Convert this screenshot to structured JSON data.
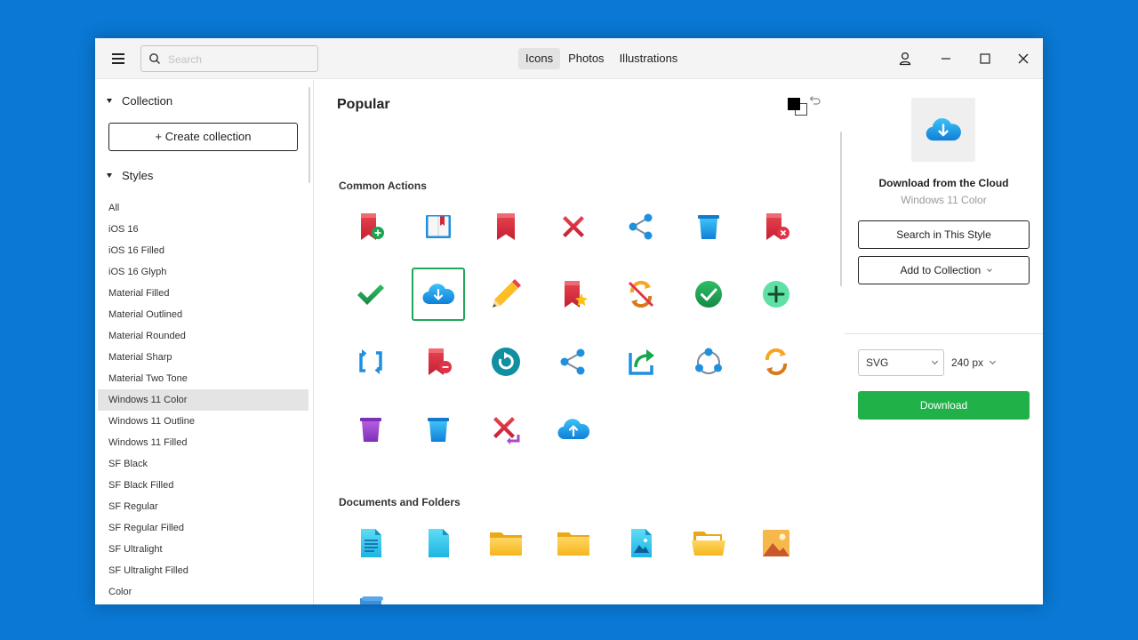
{
  "titlebar": {
    "search_placeholder": "Search",
    "tabs": [
      {
        "label": "Icons",
        "active": true
      },
      {
        "label": "Photos",
        "active": false
      },
      {
        "label": "Illustrations",
        "active": false
      }
    ]
  },
  "sidebar": {
    "collection_heading": "Collection",
    "create_collection_label": "+ Create collection",
    "styles_heading": "Styles",
    "styles": [
      "All",
      "iOS 16",
      "iOS 16 Filled",
      "iOS 16 Glyph",
      "Material Filled",
      "Material Outlined",
      "Material Rounded",
      "Material Sharp",
      "Material Two Tone",
      "Windows 11 Color",
      "Windows 11 Outline",
      "Windows 11 Filled",
      "SF Black",
      "SF Black Filled",
      "SF Regular",
      "SF Regular Filled",
      "SF Ultralight",
      "SF Ultralight Filled",
      "Color"
    ],
    "selected_style": "Windows 11 Color"
  },
  "main": {
    "title": "Popular",
    "sections": [
      {
        "title": "Common Actions",
        "icons": [
          "bookmark-add-icon",
          "book-icon",
          "bookmark-icon",
          "close-icon",
          "share-nodes-icon",
          "trash-icon",
          "bookmark-remove-icon",
          "checkmark-icon",
          "cloud-download-icon",
          "pencil-icon",
          "bookmark-star-icon",
          "no-sync-icon",
          "check-circle-icon",
          "add-circle-icon",
          "refresh-arrows-icon",
          "bookmark-minus-icon",
          "reload-circle-icon",
          "share-icon",
          "share-export-icon",
          "connection-ring-icon",
          "sync-icon",
          "purple-trash-icon",
          "blue-trash-icon",
          "delete-return-icon",
          "cloud-upload-icon"
        ]
      },
      {
        "title": "Documents and Folders",
        "icons": [
          "document-icon",
          "blank-file-icon",
          "folder-icon",
          "folder-closed-icon",
          "image-file-icon",
          "open-folder-icon",
          "picture-icon",
          "scroll-icon"
        ]
      }
    ],
    "selected_icon": "cloud-download-icon"
  },
  "right_panel": {
    "icon_name": "Download from the Cloud",
    "icon_style": "Windows 11 Color",
    "search_style_label": "Search in This Style",
    "add_collection_label": "Add to Collection",
    "format_value": "SVG",
    "size_value": "240 px",
    "download_label": "Download"
  },
  "colors": {
    "background": "#0a78d4",
    "accent_green": "#20b249",
    "selection_green": "#21a65a"
  }
}
